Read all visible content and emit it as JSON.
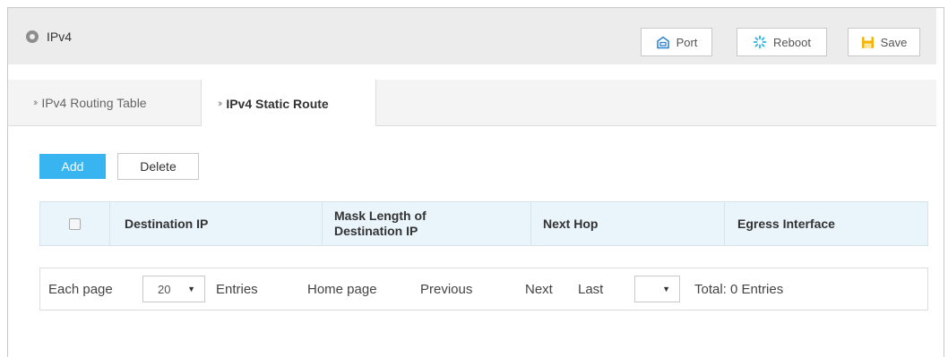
{
  "header": {
    "title": "IPv4",
    "title_icon": "circle-icon",
    "buttons": {
      "port": "Port",
      "reboot": "Reboot",
      "save": "Save"
    },
    "colors": {
      "port_icon": "#2b7fd1",
      "reboot_icon": "#2bb3e8",
      "save_icon": "#f5b400"
    }
  },
  "tabs": [
    {
      "label": "IPv4 Routing Table",
      "active": false
    },
    {
      "label": "IPv4 Static Route",
      "active": true
    }
  ],
  "toolbar": {
    "add_label": "Add",
    "delete_label": "Delete",
    "add_color": "#38b4f0"
  },
  "table": {
    "columns": [
      "Destination IP",
      "Mask Length of Destination IP",
      "Next Hop",
      "Egress Interface"
    ],
    "mask_header_line1": "Mask Length of",
    "mask_header_line2": "Destination IP",
    "rows": []
  },
  "pagination": {
    "each_page_label": "Each page",
    "page_size": "20",
    "entries_label": "Entries",
    "home_label": "Home page",
    "previous_label": "Previous",
    "next_label": "Next",
    "last_label": "Last",
    "current_page": "",
    "total_label": "Total: 0 Entries"
  }
}
